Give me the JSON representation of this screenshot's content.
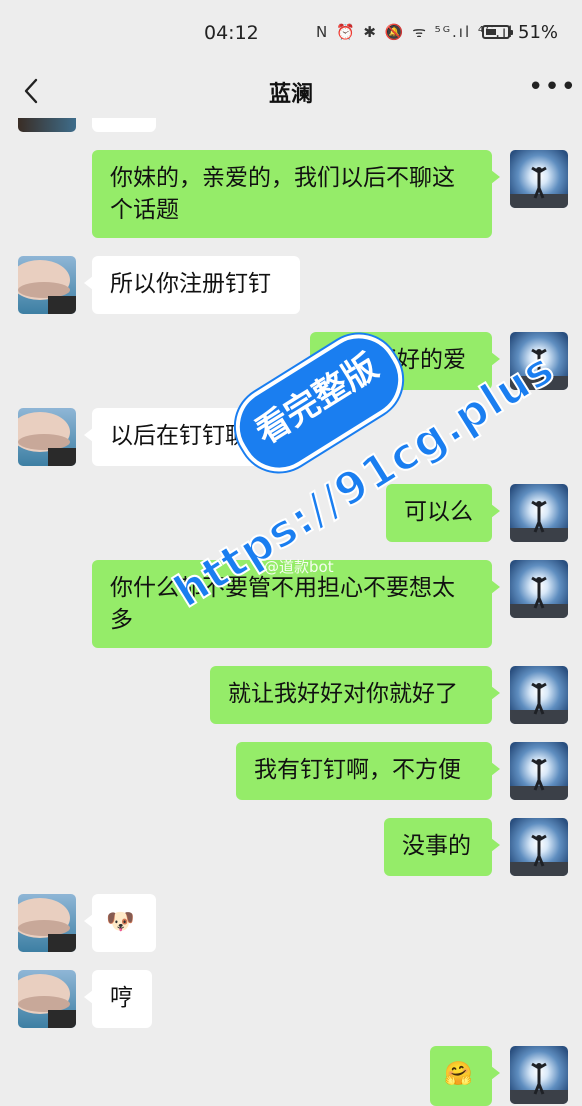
{
  "status_bar": {
    "time": "04:12",
    "icons": "N ⏰ ✱ 🔕 ᯤ ⁵ᴳ.ıl ⁴ᴳ.ıl",
    "battery_level": 0.51,
    "battery_text": "51%"
  },
  "header": {
    "title": "蓝澜",
    "back_icon": "chevron-left-icon",
    "more_icon": "more-dots-icon",
    "more_text": "•••"
  },
  "messages": [
    {
      "side": "right",
      "text": "你妹的，亲爱的，我们以后不聊这个话题"
    },
    {
      "side": "left",
      "text": "所以你注册钉钉"
    },
    {
      "side": "right",
      "text": "我们好好的爱"
    },
    {
      "side": "left",
      "text": "以后在钉钉聊"
    },
    {
      "side": "right",
      "text": "可以么"
    },
    {
      "side": "right",
      "text": "你什么都不要管不用担心不要想太多"
    },
    {
      "side": "right",
      "text": "就让我好好对你就好了"
    },
    {
      "side": "right",
      "text": "我有钉钉啊，不方便"
    },
    {
      "side": "right",
      "text": "没事的"
    },
    {
      "side": "left",
      "text": "🐶"
    },
    {
      "side": "left",
      "text": "哼"
    },
    {
      "side": "right",
      "text": "🤗"
    }
  ],
  "watermark": {
    "badge": "看完整版",
    "url": "https://91cg.plus",
    "weibo": "@道款bot"
  }
}
